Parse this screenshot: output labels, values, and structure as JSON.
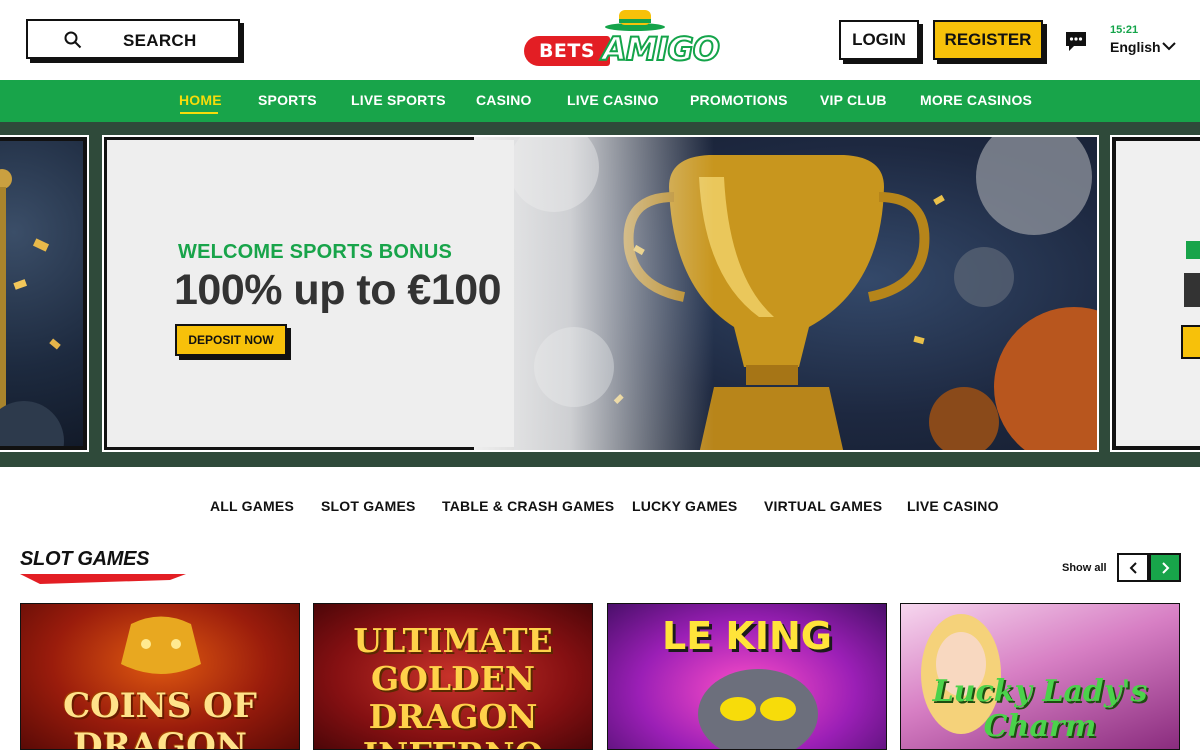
{
  "header": {
    "search_label": "SEARCH",
    "logo_text_left": "BETS",
    "logo_text_right": "AMIGO",
    "login_label": "LOGIN",
    "register_label": "REGISTER",
    "time": "15:21",
    "language": "English"
  },
  "nav": {
    "items": [
      {
        "label": "HOME",
        "active": true
      },
      {
        "label": "SPORTS"
      },
      {
        "label": "LIVE SPORTS"
      },
      {
        "label": "CASINO"
      },
      {
        "label": "LIVE CASINO"
      },
      {
        "label": "PROMOTIONS"
      },
      {
        "label": "VIP CLUB"
      },
      {
        "label": "MORE CASINOS"
      }
    ]
  },
  "hero": {
    "kicker": "WELCOME SPORTS BONUS",
    "headline": "100% up to €100",
    "cta_label": "DEPOSIT NOW"
  },
  "game_tabs": [
    "ALL GAMES",
    "SLOT GAMES",
    "TABLE & CRASH GAMES",
    "LUCKY GAMES",
    "VIRTUAL GAMES",
    "LIVE CASINO"
  ],
  "section": {
    "title": "SLOT GAMES",
    "show_all_label": "Show all"
  },
  "games": [
    {
      "title": "COINS OF DRAGON"
    },
    {
      "title": "ULTIMATE GOLDEN DRAGON INFERNO"
    },
    {
      "title": "LE KING"
    },
    {
      "title": "Lucky Lady's Charm"
    }
  ],
  "colors": {
    "brand_green": "#18a44a",
    "brand_yellow": "#f7c10a",
    "brand_red": "#e31e24",
    "active_nav": "#f7dc0a"
  }
}
